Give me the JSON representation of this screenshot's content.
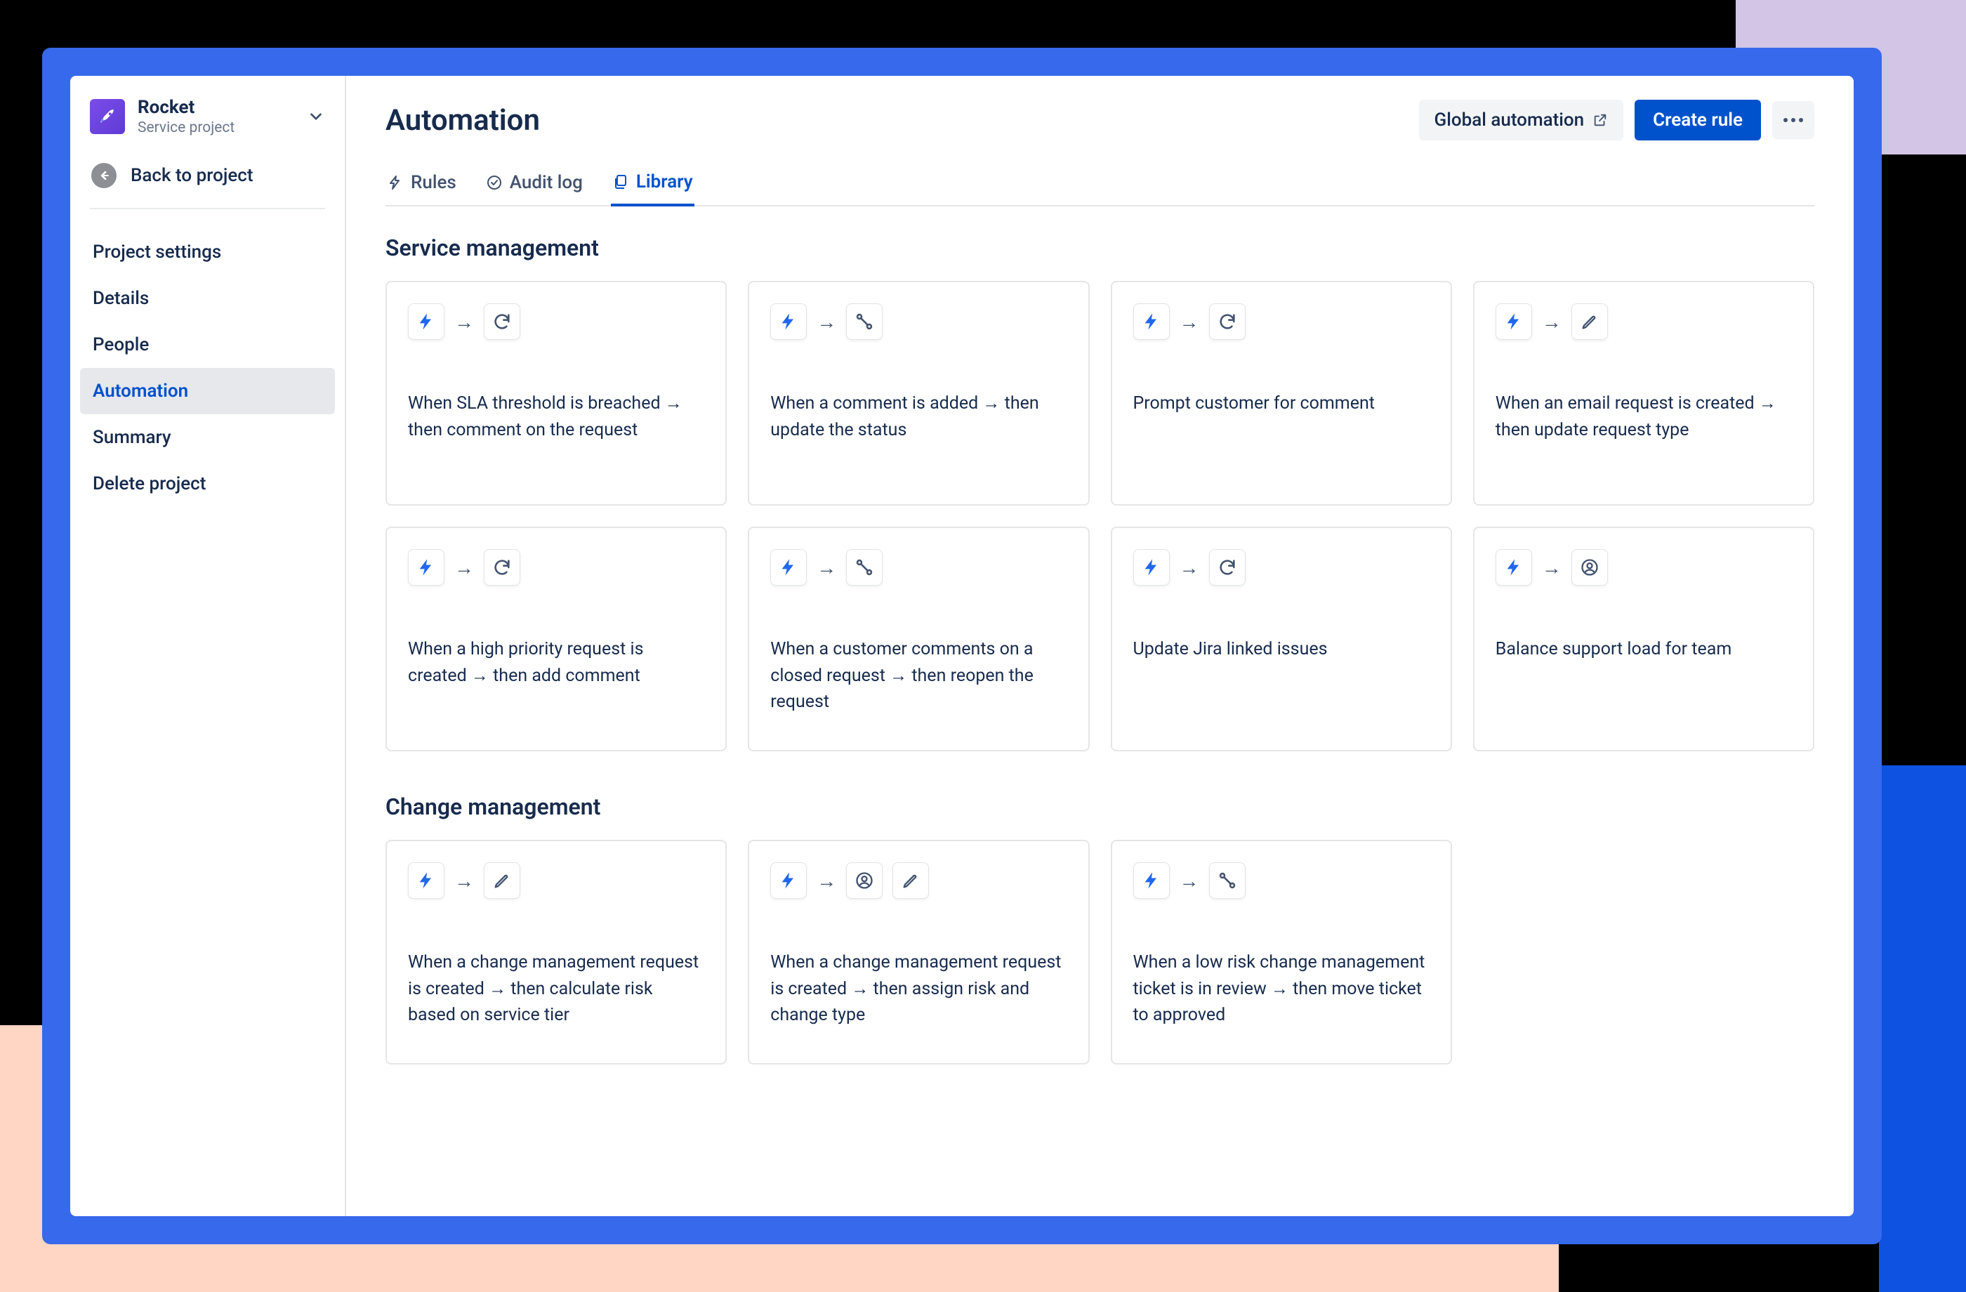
{
  "sidebar": {
    "project_name": "Rocket",
    "project_sub": "Service project",
    "back_label": "Back to project",
    "nav": [
      {
        "label": "Project settings"
      },
      {
        "label": "Details"
      },
      {
        "label": "People"
      },
      {
        "label": "Automation"
      },
      {
        "label": "Summary"
      },
      {
        "label": "Delete project"
      }
    ],
    "active_index": 3
  },
  "main": {
    "title": "Automation",
    "global_label": "Global automation",
    "create_label": "Create rule",
    "tabs": [
      {
        "label": "Rules",
        "icon": "lightning"
      },
      {
        "label": "Audit log",
        "icon": "check-circle"
      },
      {
        "label": "Library",
        "icon": "copy"
      }
    ],
    "active_tab": 2,
    "sections": [
      {
        "title": "Service management",
        "cards": [
          {
            "icons": [
              "lightning",
              "refresh"
            ],
            "text": "When SLA threshold is breached → then comment on the request"
          },
          {
            "icons": [
              "lightning",
              "branch"
            ],
            "text": "When a comment is added → then update the status"
          },
          {
            "icons": [
              "lightning",
              "refresh"
            ],
            "text": "Prompt customer for comment"
          },
          {
            "icons": [
              "lightning",
              "pencil"
            ],
            "text": "When an email request is created → then update request type"
          },
          {
            "icons": [
              "lightning",
              "refresh"
            ],
            "text": "When a high priority request is created → then add comment"
          },
          {
            "icons": [
              "lightning",
              "branch"
            ],
            "text": "When a customer comments on a closed request → then reopen the request"
          },
          {
            "icons": [
              "lightning",
              "refresh"
            ],
            "text": "Update Jira linked issues"
          },
          {
            "icons": [
              "lightning",
              "person"
            ],
            "text": "Balance support load for team"
          }
        ]
      },
      {
        "title": "Change management",
        "cards": [
          {
            "icons": [
              "lightning",
              "pencil"
            ],
            "text": "When a change management request is created → then calculate risk based on service tier"
          },
          {
            "icons": [
              "lightning",
              "person",
              "pencil"
            ],
            "text": "When a change management request is created → then assign risk and change type"
          },
          {
            "icons": [
              "lightning",
              "branch"
            ],
            "text": "When a low risk change management ticket is in review → then move ticket to approved"
          }
        ]
      }
    ]
  }
}
